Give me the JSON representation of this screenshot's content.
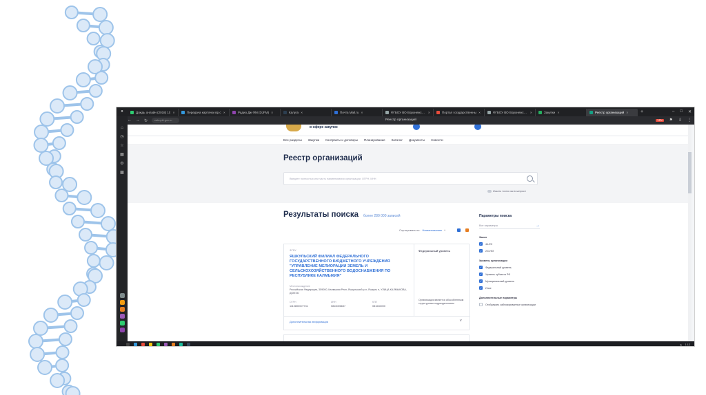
{
  "browser": {
    "tabs": [
      {
        "label": "Дождь онлайн (2018) 10",
        "color": "#2ecc71"
      },
      {
        "label": "Передача карточки вр.с",
        "color": "#3498db"
      },
      {
        "label": "Радио Дж ФМ (DJFM)",
        "color": "#8e44ad"
      },
      {
        "label": "Калуга",
        "color": "#2c3e50"
      },
      {
        "label": "Почта Mail.ru",
        "color": "#2f6fd6"
      },
      {
        "label": "ФГБОУ ВО Воронежский",
        "color": "#95a5a6"
      },
      {
        "label": "Портал государственны",
        "color": "#e74c3c"
      },
      {
        "label": "ФГБОУ ВО Воронежский",
        "color": "#95a5a6"
      },
      {
        "label": "Закупки",
        "color": "#27ae60"
      },
      {
        "label": "Реестр организаций",
        "color": "#16a085",
        "active": true
      }
    ],
    "url": "zakupki.gov.ru",
    "page_title": "Реестр организаций",
    "vpn_label": "VPN"
  },
  "site": {
    "name": "в сфере закупок",
    "nav": [
      "Все разделы",
      "Закупки",
      "Контракты и договоры",
      "Планирование",
      "Каталог",
      "Документы",
      "Новости"
    ]
  },
  "registry": {
    "title": "Реестр организаций",
    "search_placeholder": "Введите полностью или часть наименования организации, ОГРН, ИНН",
    "exact_search": "Искать точно как в запросе"
  },
  "results": {
    "title": "Результаты поиска",
    "count": "более 280 000 записей",
    "sort_label": "Сортировать по:",
    "sort_value": "Наименованию",
    "card": {
      "type": "ФГБУ",
      "name": "ЯШКУЛЬСКИЙ ФИЛИАЛ ФЕДЕРАЛЬНОГО ГОСУДАРСТВЕННОГО БЮДЖЕТНОГО УЧРЕЖДЕНИЯ \"УПРАВЛЕНИЕ МЕЛИОРАЦИИ ЗЕМЕЛЬ И СЕЛЬСКОХОЗЯЙСТВЕННОГО ВОДОСНАБЖЕНИЯ ПО РЕСПУБЛИКЕ КАЛМЫКИЯ\"",
      "side_title": "Федеральный уровень",
      "address_label": "Местонахождение",
      "address": "Российская Федерация, 359000, Калмыкия Респ, Яшкульский р-н, Яшкуль п, УЛИЦА КАЛМЫКОВА, ДОМ 60",
      "meta": [
        {
          "label": "ОГРН",
          "value": "1110800007741"
        },
        {
          "label": "ИНН",
          "value": "0816006637"
        },
        {
          "label": "КПП",
          "value": "081602000"
        }
      ],
      "side_note": "Организация является обособленным структурным подразделением",
      "more": "Дополнительная информация"
    }
  },
  "filters": {
    "title": "Параметры поиска",
    "search_placeholder": "Все параметры",
    "law_group": "Закон",
    "laws": [
      {
        "label": "44-ФЗ",
        "checked": true
      },
      {
        "label": "223-ФЗ",
        "checked": true
      }
    ],
    "level_group": "Уровень организации",
    "levels": [
      {
        "label": "Федеральный уровень",
        "checked": true
      },
      {
        "label": "Уровень субъекта РФ",
        "checked": true
      },
      {
        "label": "Муниципальный уровень",
        "checked": true
      },
      {
        "label": "Иное",
        "checked": true
      }
    ],
    "extra_group": "Дополнительные параметры",
    "extras": [
      {
        "label": "Отображать заблокированные организации",
        "checked": false
      }
    ]
  },
  "taskbar": {
    "time": "1:12"
  },
  "colors": {
    "accent": "#2f6fd6",
    "title": "#1f2d4d",
    "dna": "#9ec4ea"
  }
}
